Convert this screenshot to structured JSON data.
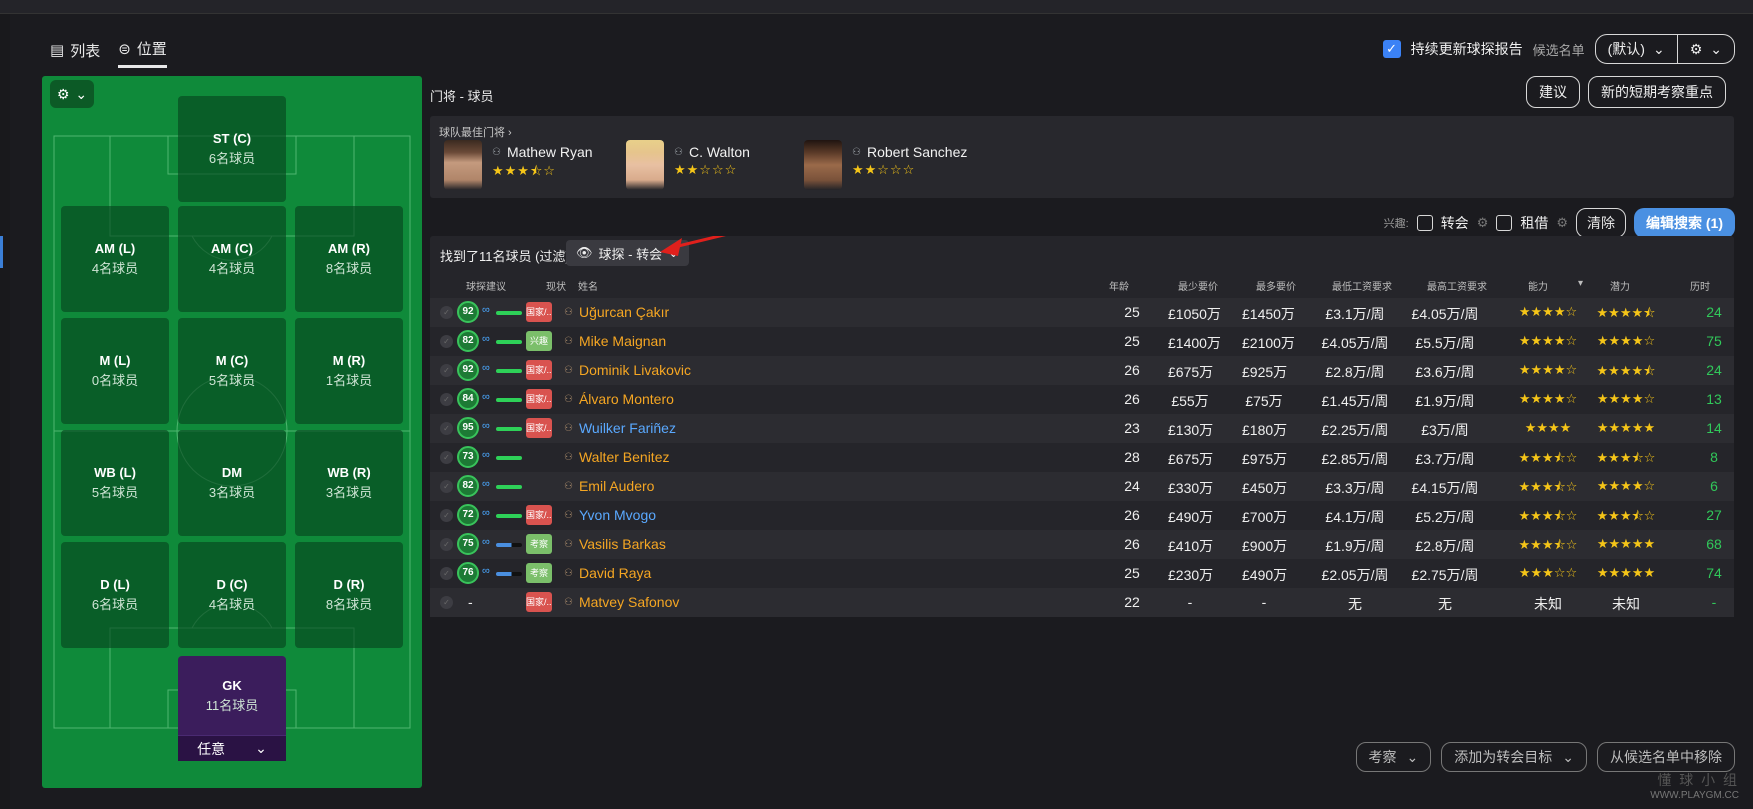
{
  "view_toggle": {
    "list_label": "列表",
    "position_label": "位置"
  },
  "header": {
    "auto_update_label": "持续更新球探报告",
    "shortlist_label": "候选名单",
    "shortlist_value": "(默认)"
  },
  "pitch": {
    "positions": [
      {
        "name": "ST (C)",
        "count": "6名球员"
      },
      {
        "name": "AM (L)",
        "count": "4名球员"
      },
      {
        "name": "AM (C)",
        "count": "4名球员"
      },
      {
        "name": "AM (R)",
        "count": "8名球员"
      },
      {
        "name": "M (L)",
        "count": "0名球员"
      },
      {
        "name": "M (C)",
        "count": "5名球员"
      },
      {
        "name": "M (R)",
        "count": "1名球员"
      },
      {
        "name": "WB (L)",
        "count": "5名球员"
      },
      {
        "name": "DM",
        "count": "3名球员"
      },
      {
        "name": "WB (R)",
        "count": "3名球员"
      },
      {
        "name": "D (L)",
        "count": "6名球员"
      },
      {
        "name": "D (C)",
        "count": "4名球员"
      },
      {
        "name": "D (R)",
        "count": "8名球员"
      },
      {
        "name": "GK",
        "count": "11名球员"
      }
    ],
    "gk_select": "任意"
  },
  "main": {
    "title": "门将 - 球员",
    "suggest_label": "建议",
    "new_focus_label": "新的短期考察重点",
    "best_title": "球队最佳门将",
    "best_keepers": [
      {
        "name": "Mathew Ryan",
        "stars": "★★★⯪☆"
      },
      {
        "name": "C. Walton",
        "stars": "★★☆☆☆"
      },
      {
        "name": "Robert Sanchez",
        "stars": "★★☆☆☆"
      }
    ],
    "interest_label": "兴趣:",
    "transfer_label": "转会",
    "loan_label": "租借",
    "clear_label": "清除",
    "edit_search_label": "编辑搜索 (1)",
    "found_label": "找到了11名球员 (过滤)",
    "view_label": "球探 - 转会"
  },
  "table": {
    "headers": {
      "rec": "球探建议",
      "status": "现状",
      "name": "姓名",
      "age": "年龄",
      "min_price": "最少要价",
      "max_price": "最多要价",
      "min_wage": "最低工资要求",
      "max_wage": "最高工资要求",
      "ability": "能力",
      "potential": "潜力",
      "history": "历时"
    },
    "rows": [
      {
        "rec": "92",
        "status": "国家/...",
        "status_color": "red",
        "name": "Uğurcan Çakır",
        "age": "25",
        "min_price": "£1050万",
        "max_price": "£1450万",
        "min_wage": "£3.1万/周",
        "max_wage": "£4.05万/周",
        "ability": "★★★★☆",
        "potential": "★★★★⯪",
        "history": "24"
      },
      {
        "rec": "82",
        "status": "兴趣",
        "status_color": "green",
        "name": "Mike Maignan",
        "age": "25",
        "min_price": "£1400万",
        "max_price": "£2100万",
        "min_wage": "£4.05万/周",
        "max_wage": "£5.5万/周",
        "ability": "★★★★☆",
        "potential": "★★★★☆",
        "history": "75"
      },
      {
        "rec": "92",
        "status": "国家/...",
        "status_color": "red",
        "name": "Dominik Livakovic",
        "age": "26",
        "min_price": "£675万",
        "max_price": "£925万",
        "min_wage": "£2.8万/周",
        "max_wage": "£3.6万/周",
        "ability": "★★★★☆",
        "potential": "★★★★⯪",
        "history": "24"
      },
      {
        "rec": "84",
        "status": "国家/...",
        "status_color": "red",
        "name": "Álvaro Montero",
        "age": "26",
        "min_price": "£55万",
        "max_price": "£75万",
        "min_wage": "£1.45万/周",
        "max_wage": "£1.9万/周",
        "ability": "★★★★☆",
        "potential": "★★★★☆",
        "history": "13"
      },
      {
        "rec": "95",
        "status": "国家/...",
        "status_color": "red",
        "name": "Wuilker Fariñez",
        "age": "23",
        "min_price": "£130万",
        "max_price": "£180万",
        "min_wage": "£2.25万/周",
        "max_wage": "£3万/周",
        "ability": "★★★★",
        "potential": "★★★★★",
        "history": "14"
      },
      {
        "rec": "73",
        "status": "",
        "status_color": "",
        "name": "Walter Benitez",
        "age": "28",
        "min_price": "£675万",
        "max_price": "£975万",
        "min_wage": "£2.85万/周",
        "max_wage": "£3.7万/周",
        "ability": "★★★⯪☆",
        "potential": "★★★⯪☆",
        "history": "8"
      },
      {
        "rec": "82",
        "status": "",
        "status_color": "",
        "name": "Emil Audero",
        "age": "24",
        "min_price": "£330万",
        "max_price": "£450万",
        "min_wage": "£3.3万/周",
        "max_wage": "£4.15万/周",
        "ability": "★★★⯪☆",
        "potential": "★★★★☆",
        "history": "6"
      },
      {
        "rec": "72",
        "status": "国家/...",
        "status_color": "red",
        "name": "Yvon Mvogo",
        "age": "26",
        "min_price": "£490万",
        "max_price": "£700万",
        "min_wage": "£4.1万/周",
        "max_wage": "£5.2万/周",
        "ability": "★★★⯪☆",
        "potential": "★★★⯪☆",
        "history": "27"
      },
      {
        "rec": "75",
        "status": "考察",
        "status_color": "green",
        "name": "Vasilis Barkas",
        "age": "26",
        "min_price": "£410万",
        "max_price": "£900万",
        "min_wage": "£1.9万/周",
        "max_wage": "£2.8万/周",
        "ability": "★★★⯪☆",
        "potential": "★★★★★",
        "history": "68"
      },
      {
        "rec": "76",
        "status": "考察",
        "status_color": "green",
        "name": "David Raya",
        "age": "25",
        "min_price": "£230万",
        "max_price": "£490万",
        "min_wage": "£2.05万/周",
        "max_wage": "£2.75万/周",
        "ability": "★★★☆☆",
        "potential": "★★★★★",
        "history": "74"
      },
      {
        "rec": "-",
        "status": "国家/...",
        "status_color": "red",
        "name": "Matvey Safonov",
        "age": "22",
        "min_price": "-",
        "max_price": "-",
        "min_wage": "无",
        "max_wage": "无",
        "ability": "未知",
        "potential": "未知",
        "history": "-"
      }
    ]
  },
  "bottom": {
    "scout_label": "考察",
    "add_target_label": "添加为转会目标",
    "remove_label": "从候选名单中移除"
  },
  "watermark": {
    "line1": "懂 球 小 组",
    "line2": "WWW.PLAYGM.CC"
  },
  "colors": {
    "pitch": "#0f8a3a",
    "accent": "#4a90e2",
    "name_orange": "#f5a623",
    "name_blue": "#5aa9ff",
    "history_green": "#31c85a"
  }
}
